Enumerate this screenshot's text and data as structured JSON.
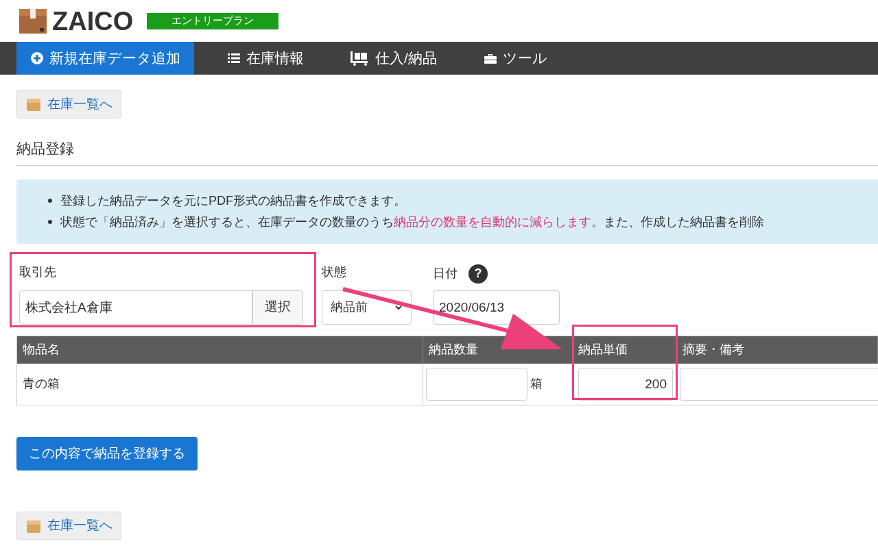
{
  "header": {
    "logo": "ZAICO",
    "plan_badge": "エントリープラン"
  },
  "nav": [
    {
      "label": "新規在庫データ追加",
      "kind": "add",
      "selected": true
    },
    {
      "label": "在庫情報",
      "kind": "list",
      "selected": false
    },
    {
      "label": "仕入/納品",
      "kind": "cart",
      "selected": false
    },
    {
      "label": "ツール",
      "kind": "toolbox",
      "selected": false
    }
  ],
  "back_link_top": "在庫一覧へ",
  "section_title": "納品登録",
  "info": [
    [
      {
        "text": "登録した納品データを元にPDF形式の納品書を作成できます。",
        "highlight": false
      }
    ],
    [
      {
        "text": "状態で「納品済み」を選択すると、在庫データの数量のうち",
        "highlight": false
      },
      {
        "text": "納品分の数量を自動的に減らします",
        "highlight": true
      },
      {
        "text": "。また、作成した納品書を削除",
        "highlight": false
      }
    ]
  ],
  "form": {
    "customer": {
      "label": "取引先",
      "value": "株式会社A倉庫",
      "button": "選択"
    },
    "status": {
      "label": "状態",
      "value": "納品前"
    },
    "date": {
      "label": "日付",
      "value": "2020/06/13",
      "help": "?"
    }
  },
  "table": {
    "columns": [
      "物品名",
      "納品数量",
      "納品単価",
      "摘要・備考"
    ],
    "rows": [
      {
        "name": "青の箱",
        "quantity": "",
        "unit": "箱",
        "price": "200",
        "note": ""
      }
    ]
  },
  "submit": "この内容で納品を登録する",
  "back_link_bottom": "在庫一覧へ"
}
